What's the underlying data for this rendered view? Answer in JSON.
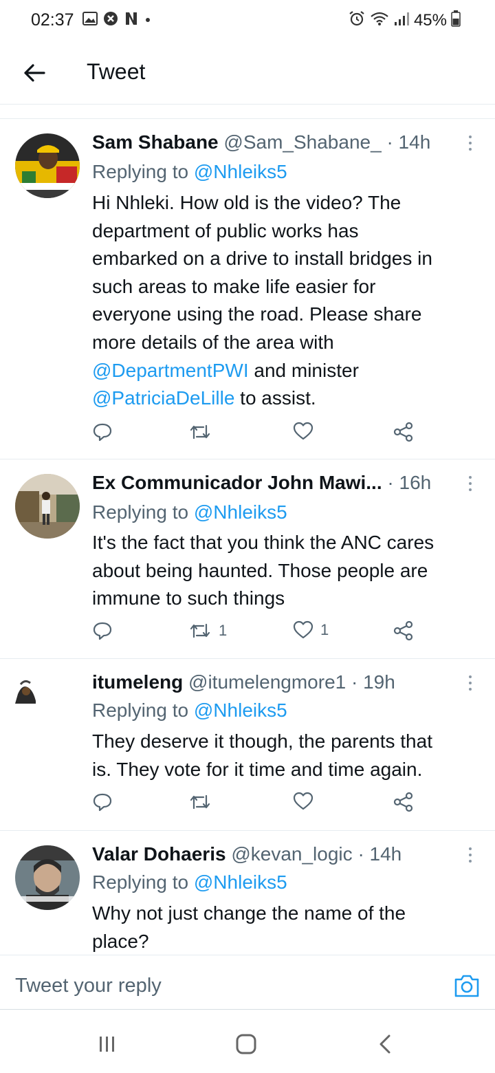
{
  "status_bar": {
    "time": "02:37",
    "battery": "45%",
    "icons": [
      "gallery-icon",
      "shield-icon",
      "netflix-icon",
      "dot-icon",
      "alarm-icon",
      "wifi-icon",
      "signal-icon",
      "battery-icon"
    ]
  },
  "header": {
    "title": "Tweet"
  },
  "tweets": [
    {
      "name": "Sam Shabane",
      "handle": "@Sam_Shabane_",
      "time": "· 14h",
      "replying_prefix": "Replying to",
      "replying_to": "@Nhleiks5",
      "body_lines": [
        "Hi Nhleki. How old is the video? The",
        "department of public works has",
        "embarked on a drive to install bridges in",
        "such areas to make life easier for",
        "everyone using the road.  Please share",
        "more details of the area with"
      ],
      "mention_1": "@DepartmentPWI",
      "text_1": " and minister",
      "mention_2": "@PatriciaDeLille",
      "text_2": " to assist.",
      "retweet_count": "",
      "like_count": ""
    },
    {
      "name": "Ex Communicador John Mawi...",
      "time": "· 16h",
      "replying_prefix": "Replying to",
      "replying_to": "@Nhleiks5",
      "body_lines": [
        "It's the fact that you think the ANC cares",
        "about being haunted. Those people are",
        "immune to such things"
      ],
      "retweet_count": "1",
      "like_count": "1"
    },
    {
      "name": "itumeleng",
      "handle": "@itumelengmore1",
      "time": "· 19h",
      "replying_prefix": "Replying to",
      "replying_to": "@Nhleiks5",
      "body_lines": [
        "They deserve it though, the parents that",
        "is. They vote for it time and time again."
      ],
      "retweet_count": "",
      "like_count": ""
    },
    {
      "name": "Valar Dohaeris",
      "handle": "@kevan_logic",
      "time": "· 14h",
      "replying_prefix": "Replying to",
      "replying_to": "@Nhleiks5",
      "body_lines": [
        "Why not just change the name of the",
        "place?"
      ]
    }
  ],
  "reply_bar": {
    "placeholder": "Tweet your reply"
  },
  "nav_bar": {
    "buttons": [
      "recents-icon",
      "home-icon",
      "back-icon"
    ]
  },
  "colors": {
    "link": "#1d9bf0",
    "muted": "#536471",
    "divider": "#e6ecf0"
  }
}
